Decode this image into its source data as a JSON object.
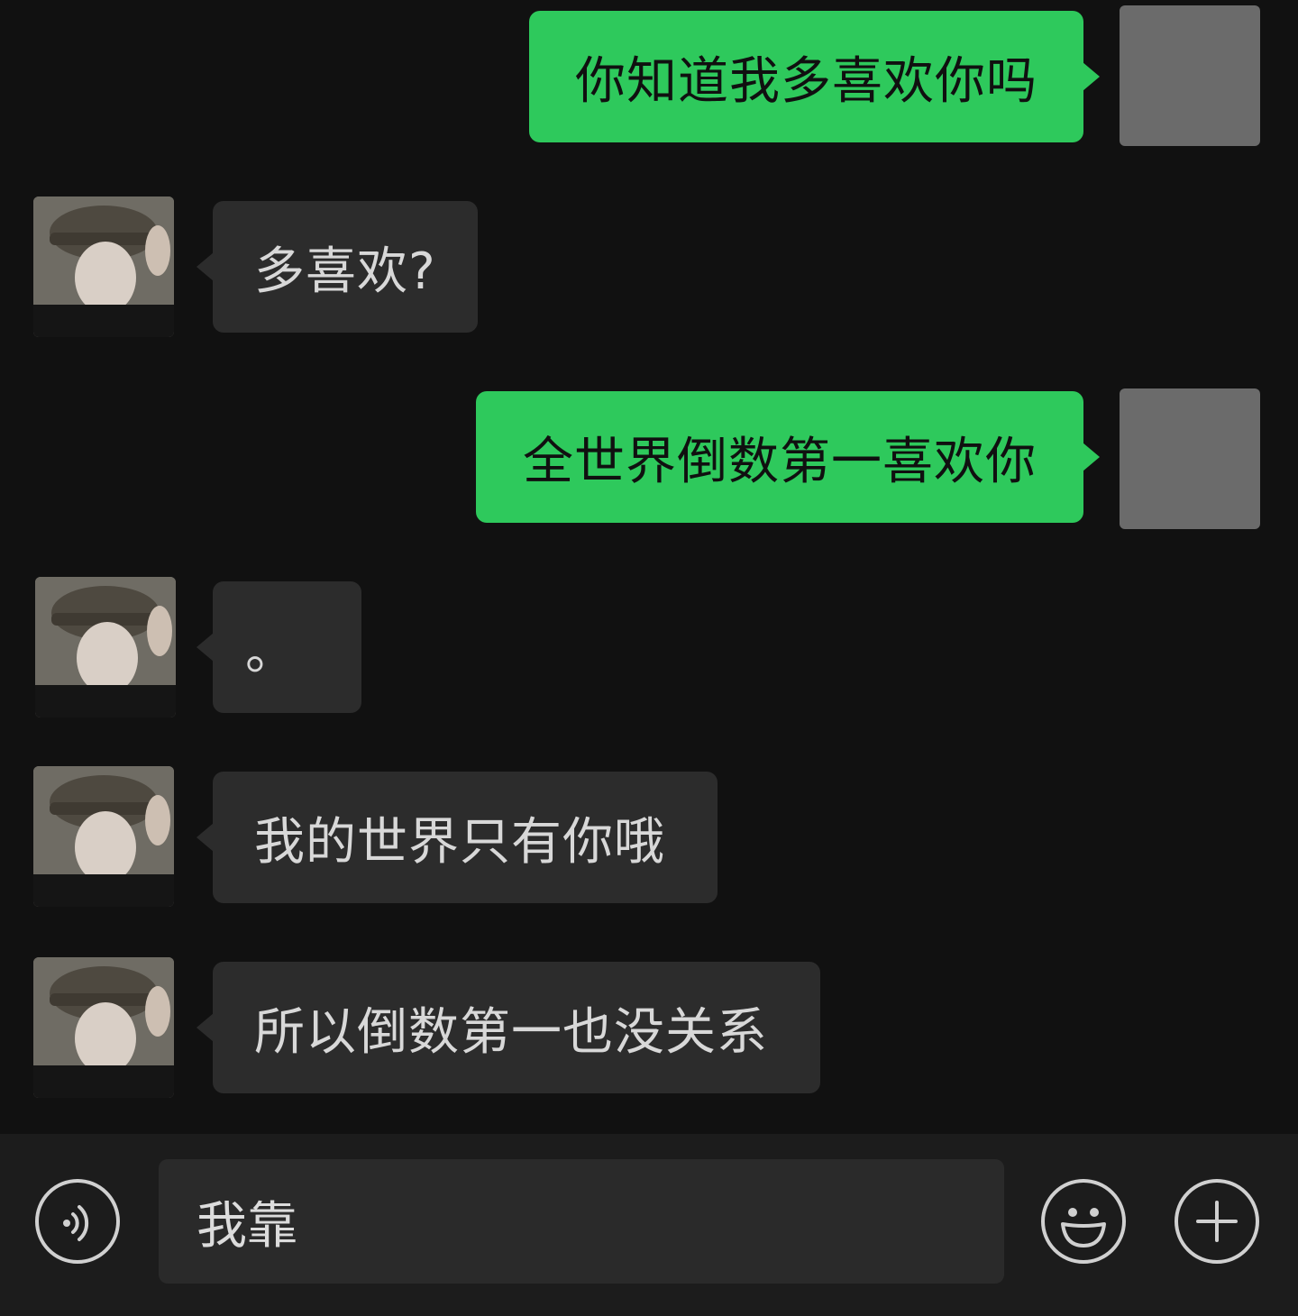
{
  "messages": [
    {
      "side": "out",
      "text": "你知道我多喜欢你吗"
    },
    {
      "side": "in",
      "text": "多喜欢?"
    },
    {
      "side": "out",
      "text": "全世界倒数第一喜欢你"
    },
    {
      "side": "in",
      "text": "。"
    },
    {
      "side": "in",
      "text": "我的世界只有你哦"
    },
    {
      "side": "in",
      "text": "所以倒数第一也没关系"
    }
  ],
  "input": {
    "value": "我靠"
  },
  "icons": {
    "voice": "voice-icon",
    "emoji": "emoji-icon",
    "more": "plus-icon"
  },
  "colors": {
    "background": "#111111",
    "outgoing_bubble": "#2ec95c",
    "incoming_bubble": "#2c2c2c",
    "input_bar": "#1c1c1c"
  }
}
